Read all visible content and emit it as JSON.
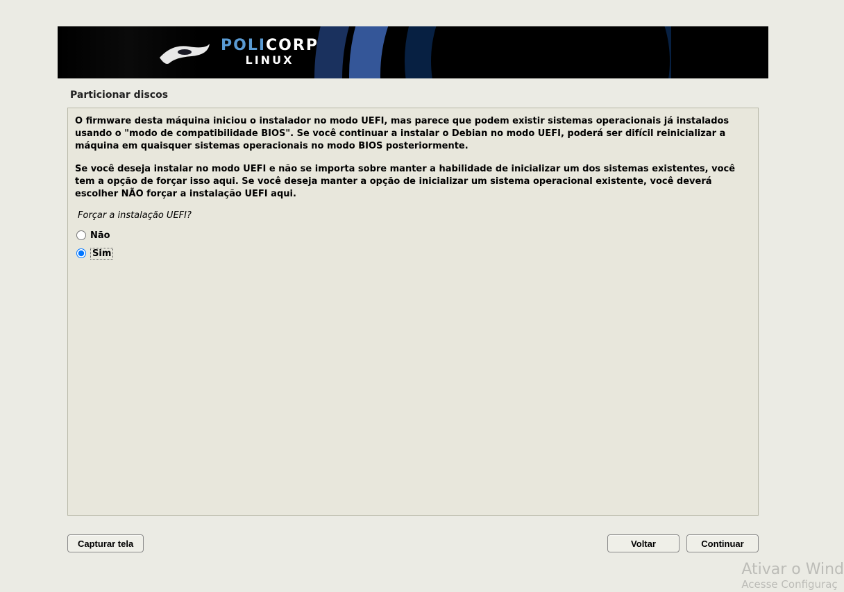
{
  "banner": {
    "brand_part1": "POLI",
    "brand_part2": "CORP",
    "subtitle": "LINUX"
  },
  "step": {
    "title": "Particionar discos"
  },
  "content": {
    "paragraph1": "O firmware desta máquina iniciou o instalador no modo UEFI, mas parece que podem existir sistemas operacionais já instalados usando o \"modo de compatibilidade BIOS\". Se você continuar a instalar o Debian no modo UEFI, poderá ser difícil reinicializar a máquina em quaisquer sistemas operacionais no modo BIOS posteriormente.",
    "paragraph2": "Se você deseja instalar no modo UEFI e não se importa sobre manter a habilidade de inicializar um dos sistemas existentes, você tem a opção de forçar isso aqui. Se você deseja manter a opção de inicializar um sistema operacional existente, você deverá escolher NÃO forçar a instalação UEFI aqui.",
    "question": "Forçar a instalação UEFI?",
    "options": {
      "no": "Não",
      "yes": "Sim"
    },
    "selected": "yes"
  },
  "buttons": {
    "screenshot": "Capturar tela",
    "back": "Voltar",
    "continue": "Continuar"
  },
  "watermark": {
    "line1": "Ativar o Wind",
    "line2": "Acesse Configuraç"
  }
}
